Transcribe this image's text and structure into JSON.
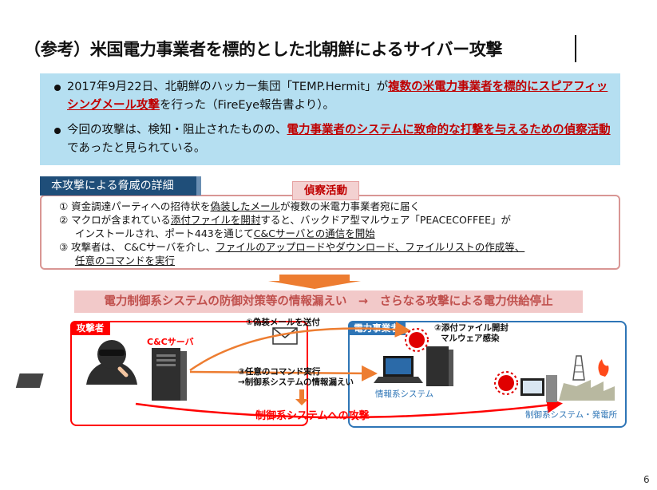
{
  "title": "（参考）米国電力事業者を標的とした北朝鮮によるサイバー攻撃",
  "summary": {
    "bullet1": {
      "pre": "2017年9月22日、北朝鮮のハッカー集団「TEMP.Hermit」が",
      "emph": "複数の米電力事業者を標的にスピアフィッシングメール攻撃",
      "post": "を行った（FireEye報告書より）。"
    },
    "bullet2": {
      "pre": "今回の攻撃は、検知・阻止されたものの、",
      "emph": "電力事業者のシステムに致命的な打撃を与えるための偵察活動",
      "post": "であったと見られている。"
    }
  },
  "details": {
    "tag": "本攻撃による脅威の詳細",
    "recon_label": "偵察活動",
    "line1": {
      "a": "① 資金調達パーティへの招待状を",
      "b": "偽装したメール",
      "c": "が複数の米電力事業者宛に届く"
    },
    "line2": {
      "a": "② マクロが含まれている",
      "b": "添付ファイルを開封",
      "c": "すると、バックドア型マルウェア「PEACECOFFEE」が"
    },
    "line3": {
      "a": "インストールされ、ポート443を通じて",
      "b": "C&Cサーバとの通信を開始",
      "c": ""
    },
    "line4": {
      "a": "③  攻撃者は、 C&Cサーバを介し、",
      "b": "ファイルのアップロードやダウンロード、ファイルリストの作成等、",
      "c": ""
    },
    "line5": {
      "a": "",
      "b": "任意のコマンドを実行",
      "c": ""
    }
  },
  "leak_banner": "電力制御系システムの防御対策等の情報漏えい　→　さらなる攻撃による電力供給停止",
  "diagram": {
    "attacker_label": "攻撃者",
    "cc_server_label": "C&Cサーバ",
    "utility_label": "電力事業者",
    "step1": "①偽装メールを送付",
    "step2a": "②添付ファイル開封",
    "step2b": "マルウェア感染",
    "step3a": "③任意のコマンド実行",
    "step3b": "→制御系システムの情報漏えい",
    "it_system": "情報系システム",
    "control_system": "制御系システム・発電所",
    "control_attack": "制御系システムへの攻撃"
  },
  "page_number": "6",
  "colors": {
    "accent_red": "#ff0000",
    "navy": "#1f4e79",
    "light_blue": "#b5dff1",
    "orange": "#ed7d31",
    "blue": "#2e75b6"
  }
}
